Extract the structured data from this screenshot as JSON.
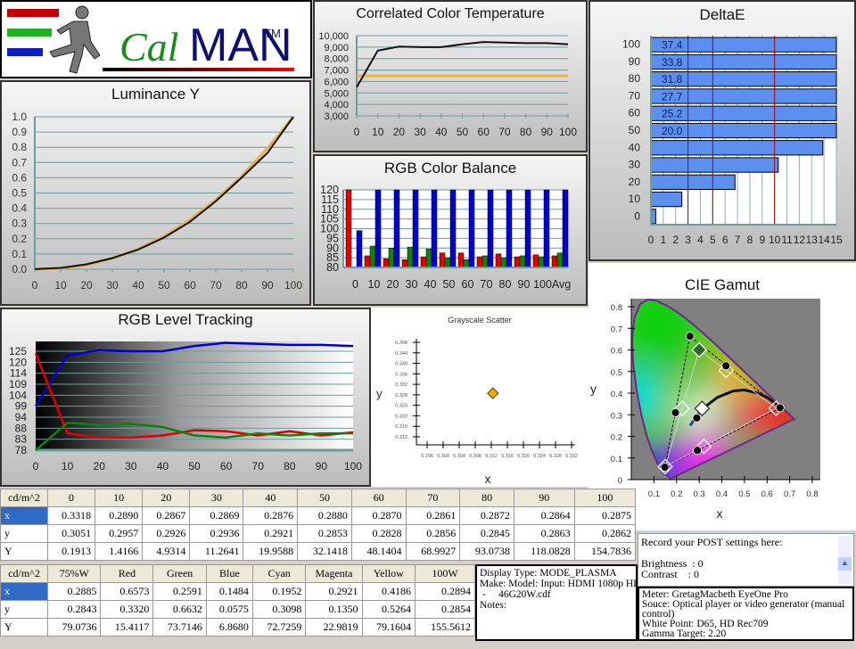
{
  "logo": {
    "text_cal": "Cal",
    "text_man": "MAN",
    "tm": "TM",
    "bar_colors": [
      "#c00000",
      "#20b020",
      "#1020c0"
    ]
  },
  "colors": {
    "grid": "#6d9c9c",
    "red": "#e00000",
    "green": "#108010",
    "blue": "#0000d0",
    "target": "#f0b040",
    "deltae_bar": "#5b8ff0",
    "deltae_ref": "#b00000"
  },
  "chart_data": [
    {
      "id": "luminance",
      "type": "line",
      "title": "Luminance Y",
      "ylim": [
        0,
        1
      ],
      "xlim": [
        0,
        100
      ],
      "yticks": [
        "0.0",
        "0.1",
        "0.2",
        "0.3",
        "0.4",
        "0.5",
        "0.6",
        "0.7",
        "0.8",
        "0.9",
        "1.0"
      ],
      "xticks": [
        "0",
        "10",
        "20",
        "30",
        "40",
        "50",
        "60",
        "70",
        "80",
        "90",
        "100"
      ],
      "x": [
        0,
        10,
        20,
        30,
        40,
        50,
        60,
        70,
        80,
        90,
        100
      ],
      "series": [
        {
          "role": "target",
          "values": [
            0,
            0.006,
            0.029,
            0.071,
            0.133,
            0.218,
            0.325,
            0.456,
            0.612,
            0.793,
            1.0
          ]
        },
        {
          "role": "measured",
          "values": [
            0.001,
            0.009,
            0.032,
            0.073,
            0.129,
            0.208,
            0.311,
            0.446,
            0.601,
            0.763,
            1.0
          ]
        }
      ]
    },
    {
      "id": "cct",
      "type": "line",
      "title": "Correlated Color Temperature",
      "ylim": [
        3000,
        10000
      ],
      "xlim": [
        0,
        100
      ],
      "yticks": [
        "3,000",
        "4,000",
        "5,000",
        "6,000",
        "7,000",
        "8,000",
        "9,000",
        "10,000"
      ],
      "xticks": [
        "0",
        "10",
        "20",
        "30",
        "40",
        "50",
        "60",
        "70",
        "80",
        "90",
        "100"
      ],
      "x": [
        0,
        10,
        20,
        30,
        40,
        50,
        60,
        70,
        80,
        90,
        100
      ],
      "target": 6500,
      "values": [
        5500,
        8700,
        9050,
        9000,
        9000,
        9250,
        9450,
        9400,
        9350,
        9350,
        9250
      ]
    },
    {
      "id": "rgb_balance",
      "type": "bar",
      "title": "RGB Color Balance",
      "ylim": [
        80,
        120
      ],
      "yticks": [
        "80",
        "85",
        "90",
        "95",
        "100",
        "105",
        "110",
        "115",
        "120"
      ],
      "categories": [
        "0",
        "10",
        "20",
        "30",
        "40",
        "50",
        "60",
        "70",
        "80",
        "90",
        "100",
        "Avg"
      ],
      "series": [
        {
          "color": "red",
          "values": [
            120,
            86,
            84.5,
            84,
            85.5,
            87.5,
            87.5,
            85.5,
            87,
            85.5,
            86.5,
            86
          ]
        },
        {
          "color": "green",
          "values": [
            80,
            91,
            90,
            90.5,
            89.5,
            85,
            84,
            86,
            85,
            86,
            85.5,
            87.5
          ]
        },
        {
          "color": "blue",
          "values": [
            99,
            120,
            120,
            120,
            120,
            120,
            120,
            120,
            120,
            120,
            120,
            120
          ]
        }
      ]
    },
    {
      "id": "deltae",
      "type": "bar",
      "orientation": "horizontal",
      "title": "DeltaE",
      "xlim": [
        0,
        15
      ],
      "xticks": [
        "0",
        "1",
        "2",
        "3",
        "4",
        "5",
        "6",
        "7",
        "8",
        "9",
        "10",
        "11",
        "12",
        "13",
        "14",
        "15"
      ],
      "categories": [
        "0",
        "10",
        "20",
        "30",
        "40",
        "50",
        "60",
        "70",
        "80",
        "90",
        "100"
      ],
      "values": [
        0.4,
        2.5,
        6.8,
        10.3,
        13.9,
        20.0,
        25.2,
        27.7,
        31.8,
        33.8,
        37.4
      ],
      "value_labels": [
        "",
        "",
        "",
        "",
        "",
        "20.0",
        "25.2",
        "27.7",
        "31.8",
        "33.8",
        "37.4"
      ],
      "reference_lines": [
        3,
        5,
        10
      ]
    },
    {
      "id": "rgb_tracking",
      "type": "line",
      "title": "RGB Level Tracking",
      "xlim": [
        0,
        100
      ],
      "yticks": [
        "78",
        "83",
        "88",
        "94",
        "99",
        "104",
        "109",
        "114",
        "120",
        "125"
      ],
      "xticks": [
        "0",
        "10",
        "20",
        "30",
        "40",
        "50",
        "60",
        "70",
        "80",
        "90",
        "100"
      ],
      "x": [
        0,
        10,
        20,
        30,
        40,
        50,
        60,
        70,
        80,
        90,
        100
      ],
      "series": [
        {
          "color": "blue",
          "values": [
            99,
            123,
            125.5,
            125,
            125,
            127.5,
            129,
            128.5,
            128,
            128,
            127.5
          ]
        },
        {
          "color": "red",
          "values": [
            124,
            86,
            84,
            84,
            85,
            87.5,
            87,
            85,
            87,
            85,
            86.5
          ]
        },
        {
          "color": "green",
          "values": [
            78,
            91,
            90,
            90.5,
            89,
            85,
            84,
            86,
            85,
            86,
            86
          ]
        }
      ]
    },
    {
      "id": "grayscale_scatter",
      "type": "scatter",
      "title": "Grayscale Scatter",
      "xlabel": "x",
      "ylabel": "y",
      "xlim": [
        0.296,
        0.332
      ],
      "ylim": [
        0.312,
        0.348
      ],
      "xticks": [
        "0.296",
        "0.300",
        "0.304",
        "0.308",
        "0.312",
        "0.316",
        "0.320",
        "0.324",
        "0.328",
        "0.332"
      ],
      "yticks": [
        "0.312",
        "0.316",
        "0.320",
        "0.324",
        "0.328",
        "0.332",
        "0.336",
        "0.340",
        "0.344",
        "0.348"
      ],
      "points": [
        {
          "x": 0.3124,
          "y": 0.3286
        }
      ]
    },
    {
      "id": "cie_gamut",
      "type": "scatter",
      "title": "CIE Gamut",
      "xlabel": "x",
      "ylabel": "y",
      "xlim": [
        0,
        0.8
      ],
      "ylim": [
        0,
        0.8
      ],
      "xticks": [
        "0.1",
        "0.2",
        "0.3",
        "0.4",
        "0.5",
        "0.6",
        "0.7",
        "0.8"
      ],
      "yticks": [
        "0",
        "0.1",
        "0.2",
        "0.3",
        "0.4",
        "0.5",
        "0.6",
        "0.7",
        "0.8"
      ],
      "measured": {
        "R": [
          0.6573,
          0.332
        ],
        "G": [
          0.2591,
          0.6632
        ],
        "B": [
          0.1484,
          0.0575
        ],
        "C": [
          0.1952,
          0.3098
        ],
        "M": [
          0.2921,
          0.135
        ],
        "Y": [
          0.4186,
          0.5264
        ],
        "W": [
          0.2894,
          0.2854
        ]
      },
      "target": {
        "R": [
          0.64,
          0.33
        ],
        "G": [
          0.3,
          0.6
        ],
        "B": [
          0.15,
          0.06
        ],
        "C": [
          0.225,
          0.329
        ],
        "M": [
          0.321,
          0.154
        ],
        "Y": [
          0.419,
          0.505
        ],
        "W": [
          0.3127,
          0.329
        ]
      }
    }
  ],
  "table1": {
    "corner": "cd/m^2",
    "headers": [
      "0",
      "10",
      "20",
      "30",
      "40",
      "50",
      "60",
      "70",
      "80",
      "90",
      "100"
    ],
    "rows": [
      {
        "label": "x",
        "cells": [
          "0.3318",
          "0.2890",
          "0.2867",
          "0.2869",
          "0.2876",
          "0.2880",
          "0.2870",
          "0.2861",
          "0.2872",
          "0.2864",
          "0.2875"
        ]
      },
      {
        "label": "y",
        "cells": [
          "0.3051",
          "0.2957",
          "0.2926",
          "0.2936",
          "0.2921",
          "0.2853",
          "0.2828",
          "0.2856",
          "0.2845",
          "0.2863",
          "0.2862"
        ]
      },
      {
        "label": "Y",
        "cells": [
          "0.1913",
          "1.4166",
          "4.9314",
          "11.2641",
          "19.9588",
          "32.1418",
          "48.1404",
          "68.9927",
          "93.0738",
          "118.0828",
          "154.7836"
        ]
      }
    ]
  },
  "table2": {
    "corner": "cd/m^2",
    "headers": [
      "75%W",
      "Red",
      "Green",
      "Blue",
      "Cyan",
      "Magenta",
      "Yellow",
      "100W"
    ],
    "rows": [
      {
        "label": "x",
        "cells": [
          "0.2885",
          "0.6573",
          "0.2591",
          "0.1484",
          "0.1952",
          "0.2921",
          "0.4186",
          "0.2894"
        ]
      },
      {
        "label": "y",
        "cells": [
          "0.2843",
          "0.3320",
          "0.6632",
          "0.0575",
          "0.3098",
          "0.1350",
          "0.5264",
          "0.2854"
        ]
      },
      {
        "label": "Y",
        "cells": [
          "79.0736",
          "15.4117",
          "73.7146",
          "6.8680",
          "72.7259",
          "22.9819",
          "79.1604",
          "155.5612"
        ]
      }
    ]
  },
  "display_info": [
    "Display Type: MODE_PLASMA",
    "Make: Model: Input: HDMI 1080p HD",
    " -     46G20W.cdf",
    "Notes:"
  ],
  "post_settings": [
    "Record your POST settings here:",
    "",
    "Brightness  : 0",
    "Contrast    : 0"
  ],
  "meter_info": [
    "Meter: GretagMacbeth EyeOne Pro",
    "Souce: Optical player or video generator (manual",
    "control)",
    "White Point: D65, HD Rec709",
    "Gamma Target: 2.20"
  ]
}
